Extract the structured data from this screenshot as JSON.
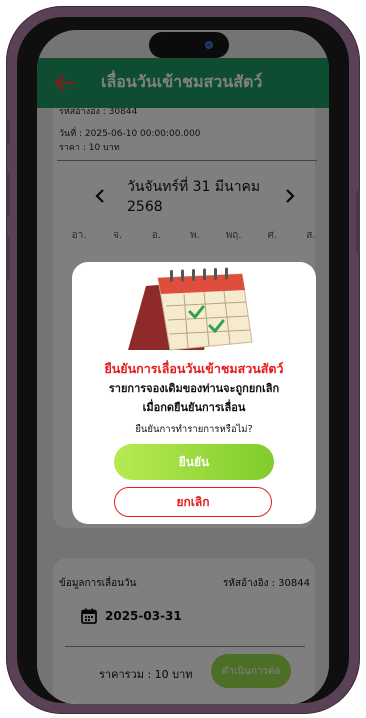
{
  "header": {
    "title": "เลื่อนวันเข้าชมสวนสัตว์",
    "back_icon": "arrow-left-icon",
    "color": "#1e9a63"
  },
  "booking": {
    "ref_line": "รหัสอ้างอิง : 30844",
    "date_line": "วันที่ : 2025-06-10 00:00:00.000",
    "price_line": "ราคา : 10 บาท"
  },
  "calendar": {
    "month_title": "วันจันทร์ที่ 31 มีนาคม 2568",
    "prev_icon": "chevron-left-icon",
    "next_icon": "chevron-right-icon",
    "weekdays": [
      "อา.",
      "จ.",
      "อ.",
      "พ.",
      "พฤ.",
      "ศ.",
      "ส."
    ]
  },
  "summary": {
    "section_label": "ข้อมูลการเลื่อนวัน",
    "ref_label": "รหัสอ้างอิง : 30844",
    "calendar_icon": "calendar-icon",
    "new_date": "2025-03-31",
    "total_label": "ราคารวม : 10 บาท",
    "proceed_label": "ดำเนินการต่อ"
  },
  "modal": {
    "illustration": "calendar-illustration",
    "title": "ยืนยันการเลื่อนวันเข้าชมสวนสัตว์",
    "body_line1": "รายการจองเดิมของท่านจะถูกยกเลิก",
    "body_line2": "เมื่อกดยืนยันการเลื่อน",
    "question": "ยืนยันการทำรายการหรือไม่?",
    "confirm_label": "ยืนยัน",
    "cancel_label": "ยกเลิก",
    "title_color": "#e51d1d",
    "confirm_color": "#8fd63a"
  }
}
